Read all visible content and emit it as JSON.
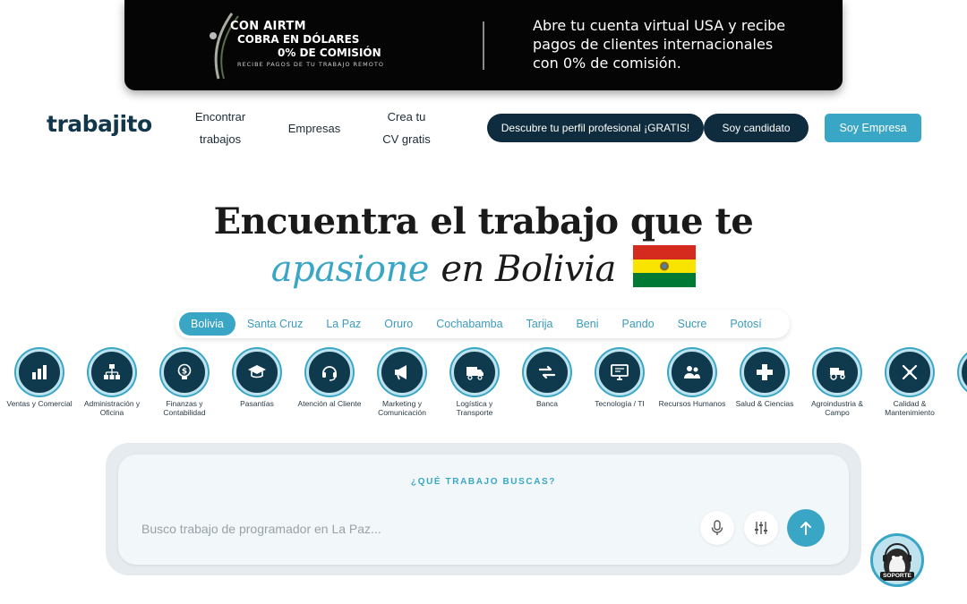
{
  "banner": {
    "line1": "CON AIRTM",
    "line2": "COBRA EN DÓLARES",
    "line3": "0% DE COMISIÓN",
    "line4": "RECIBE PAGOS DE TU TRABAJO REMOTO",
    "right_text": "Abre tu cuenta virtual USA y recibe pagos de clientes internacionales con 0% de comisión."
  },
  "nav": {
    "logo": "trabajito",
    "links": [
      {
        "line1": "Encontrar",
        "line2": "trabajos"
      },
      {
        "line1": "Empresas",
        "line2": ""
      },
      {
        "line1": "Crea tu",
        "line2": "CV gratis"
      }
    ],
    "profile_button": "Descubre tu perfil profesional ¡GRATIS!",
    "candidate_button": "Soy candidato",
    "company_button": "Soy Empresa"
  },
  "hero": {
    "line1": "Encuentra el trabajo que te",
    "accent": "apasione",
    "rest": "en Bolivia"
  },
  "cities": [
    "Bolivia",
    "Santa Cruz",
    "La Paz",
    "Oruro",
    "Cochabamba",
    "Tarija",
    "Beni",
    "Pando",
    "Sucre",
    "Potosí"
  ],
  "active_city": "Bolivia",
  "categories": [
    {
      "label": "Ventas y Comercial",
      "icon": "bar-chart-icon"
    },
    {
      "label": "Administración y Oficina",
      "icon": "org-chart-icon"
    },
    {
      "label": "Finanzas y Contabilidad",
      "icon": "lightbulb-dollar-icon"
    },
    {
      "label": "Pasantías",
      "icon": "graduation-cap-icon"
    },
    {
      "label": "Atención al Cliente",
      "icon": "headset-icon"
    },
    {
      "label": "Marketing y Comunicación",
      "icon": "megaphone-icon"
    },
    {
      "label": "Logística y Transporte",
      "icon": "truck-icon"
    },
    {
      "label": "Banca",
      "icon": "transfer-arrows-icon"
    },
    {
      "label": "Tecnología / TI",
      "icon": "monitor-icon"
    },
    {
      "label": "Recursos Humanos",
      "icon": "people-icon"
    },
    {
      "label": "Salud & Ciencias",
      "icon": "medical-cross-icon"
    },
    {
      "label": "Agroindustria & Campo",
      "icon": "tractor-icon"
    },
    {
      "label": "Calidad & Mantenimiento",
      "icon": "tools-icon"
    }
  ],
  "search": {
    "title": "¿QUÉ TRABAJO BUSCAS?",
    "placeholder": "Busco trabajo de programador en La Paz..."
  },
  "support": {
    "label": "SOPORTE"
  },
  "colors": {
    "accent": "#3aa6c6",
    "navy": "#0f2c3f",
    "flag_red": "#d52b1e",
    "flag_yellow": "#f9e300",
    "flag_green": "#007934"
  }
}
